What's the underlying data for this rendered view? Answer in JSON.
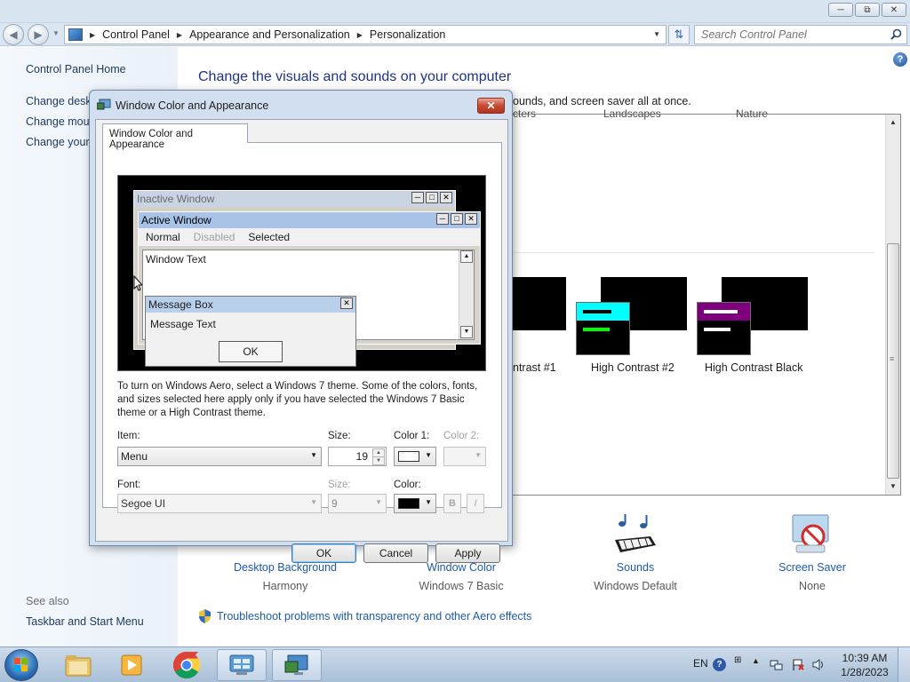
{
  "explorer": {
    "breadcrumb": [
      "Control Panel",
      "Appearance and Personalization",
      "Personalization"
    ],
    "search": {
      "placeholder": "Search Control Panel"
    }
  },
  "left_pane": {
    "home": "Control Panel Home",
    "links": [
      "Change deskt",
      "Change mous",
      "Change your"
    ],
    "see_also": "See also",
    "taskbar_link": "Taskbar and Start Menu"
  },
  "main": {
    "heading": "Change the visuals and sounds on your computer",
    "subtitle": "ounds, and screen saver all at once.",
    "theme_labels_cut": [
      "cters",
      "Landscapes",
      "Nature"
    ],
    "high_contrast": [
      {
        "label": "ntrast #1",
        "bar_color": "#00ff00"
      },
      {
        "label": "High Contrast #2",
        "bar_color": "#00ffff"
      },
      {
        "label": "High Contrast Black",
        "bar_color": "#7f007f"
      }
    ],
    "bottom_items": [
      {
        "label": "Desktop Background",
        "sub": "Harmony"
      },
      {
        "label": "Window Color",
        "sub": "Windows 7 Basic"
      },
      {
        "label": "Sounds",
        "sub": "Windows Default"
      },
      {
        "label": "Screen Saver",
        "sub": "None"
      }
    ],
    "troubleshoot": "Troubleshoot problems with transparency and other Aero effects"
  },
  "dialog": {
    "title": "Window Color and Appearance",
    "tab": "Window Color and Appearance",
    "preview": {
      "inactive_title": "Inactive Window",
      "active_title": "Active Window",
      "menu": [
        "Normal",
        "Disabled",
        "Selected"
      ],
      "window_text": "Window Text",
      "msgbox_title": "Message Box",
      "msgbox_text": "Message Text",
      "msgbox_ok": "OK"
    },
    "note": "To turn on Windows Aero, select a Windows 7 theme.  Some of the colors, fonts, and sizes selected here apply only if you have selected the Windows 7 Basic theme or a High Contrast theme.",
    "item_label": "Item:",
    "item_value": "Menu",
    "size_label": "Size:",
    "size_value": "19",
    "color1_label": "Color 1:",
    "color1_value": "#ffffff",
    "color2_label": "Color 2:",
    "font_label": "Font:",
    "font_value": "Segoe UI",
    "font_size_label": "Size:",
    "font_size_value": "9",
    "font_color_label": "Color:",
    "font_color_value": "#000000",
    "bold_label": "B",
    "italic_label": "I",
    "ok": "OK",
    "cancel": "Cancel",
    "apply": "Apply"
  },
  "taskbar": {
    "language": "EN",
    "time": "10:39 AM",
    "date": "1/28/2023"
  }
}
